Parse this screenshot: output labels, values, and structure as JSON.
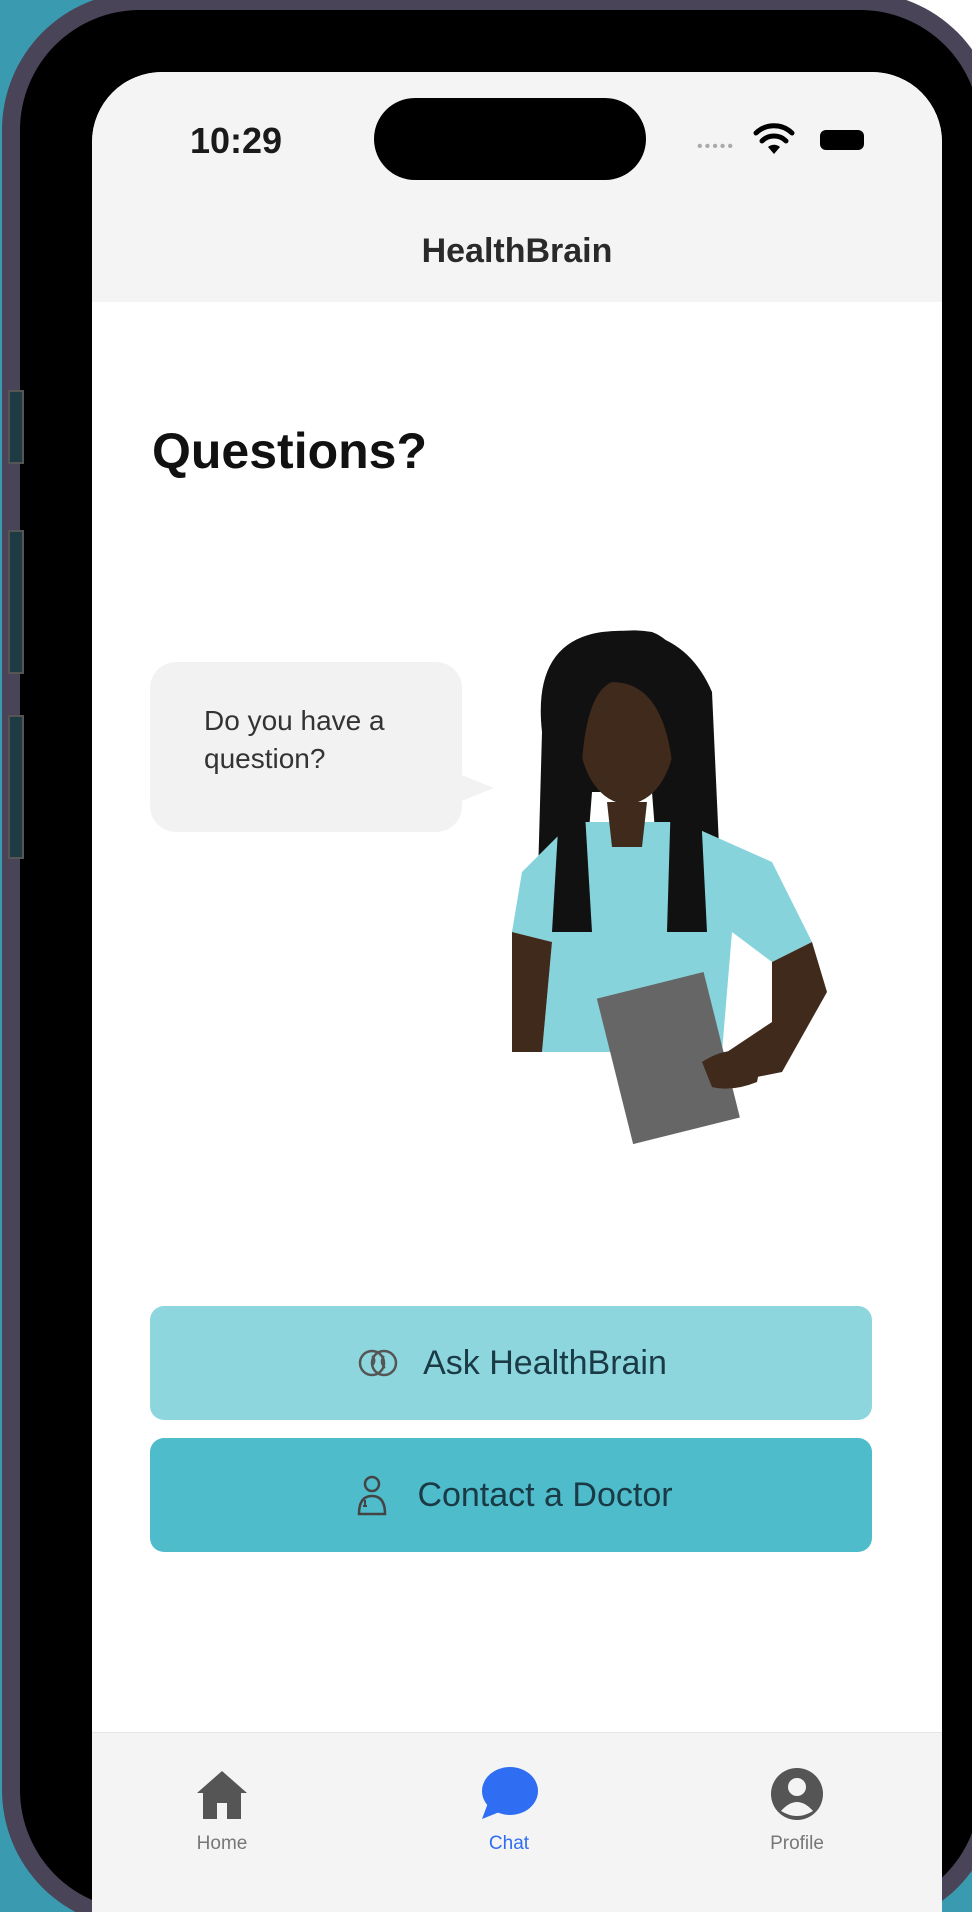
{
  "status": {
    "time": "10:29"
  },
  "header": {
    "title": "HealthBrain"
  },
  "main": {
    "title": "Questions?",
    "bubble_text": "Do you have a question?",
    "buttons": [
      {
        "label": "Ask HealthBrain",
        "icon": "brain-icon"
      },
      {
        "label": "Contact a Doctor",
        "icon": "doctor-icon"
      }
    ]
  },
  "tabbar": {
    "items": [
      {
        "label": "Home",
        "icon": "home-icon"
      },
      {
        "label": "Chat",
        "icon": "chat-bubble-icon",
        "active": true
      },
      {
        "label": "Profile",
        "icon": "profile-icon"
      }
    ]
  },
  "colors": {
    "background": "#3a9bb0",
    "ask_button": "#8dd6de",
    "contact_button": "#4fbccb",
    "active_tab": "#2f6df2"
  }
}
